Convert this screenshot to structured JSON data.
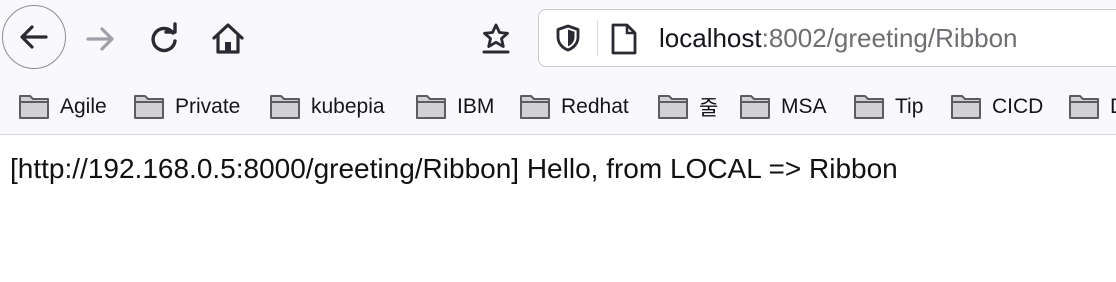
{
  "toolbar": {
    "icons": [
      "back-arrow-icon",
      "forward-arrow-icon",
      "reload-icon",
      "home-icon",
      "save-to-pocket-icon"
    ]
  },
  "urlbar": {
    "host": "localhost",
    "rest": ":8002/greeting/Ribbon",
    "icons": [
      "shield-icon",
      "page-icon"
    ]
  },
  "bookmarks": [
    {
      "label": "Agile",
      "icon": "folder-icon"
    },
    {
      "label": "Private",
      "icon": "folder-icon"
    },
    {
      "label": "kubepia",
      "icon": "folder-icon"
    },
    {
      "label": "IBM",
      "icon": "folder-icon"
    },
    {
      "label": "Redhat",
      "icon": "folder-icon"
    },
    {
      "label": "줄",
      "icon": "folder-icon"
    },
    {
      "label": "MSA",
      "icon": "folder-icon"
    },
    {
      "label": "Tip",
      "icon": "folder-icon"
    },
    {
      "label": "CICD",
      "icon": "folder-icon"
    },
    {
      "label": "D",
      "icon": "folder-icon"
    }
  ],
  "content": {
    "text": "[http://192.168.0.5:8000/greeting/Ribbon] Hello, from LOCAL => Ribbon"
  },
  "colors": {
    "toolbar_bg": "#f9f9fb",
    "icon": "#2b2a33",
    "icon_disabled": "#a0a0a8"
  }
}
